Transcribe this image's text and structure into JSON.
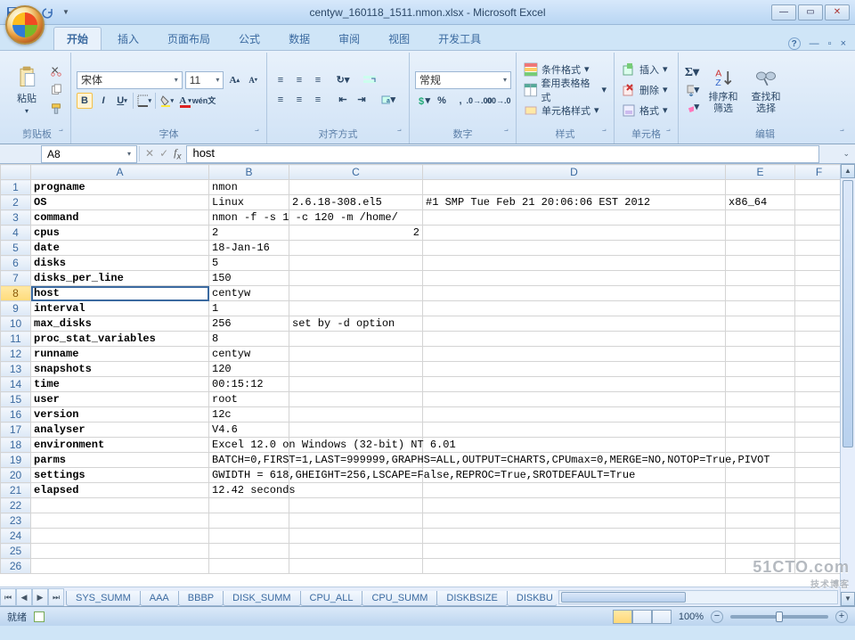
{
  "title": "centyw_160118_1511.nmon.xlsx - Microsoft Excel",
  "tabs": [
    "开始",
    "插入",
    "页面布局",
    "公式",
    "数据",
    "审阅",
    "视图",
    "开发工具"
  ],
  "active_tab": 0,
  "ribbon": {
    "clipboard": {
      "paste": "粘贴",
      "label": "剪贴板"
    },
    "font": {
      "name": "宋体",
      "size": "11",
      "label": "字体"
    },
    "align": {
      "label": "对齐方式"
    },
    "number": {
      "format": "常规",
      "label": "数字"
    },
    "styles": {
      "cond": "条件格式",
      "table": "套用表格格式",
      "cell": "单元格样式",
      "label": "样式"
    },
    "cells": {
      "insert": "插入",
      "delete": "删除",
      "format": "格式",
      "label": "单元格"
    },
    "editing": {
      "sort": "排序和\n筛选",
      "find": "查找和\n选择",
      "label": "编辑"
    }
  },
  "namebox": "A8",
  "formula": "host",
  "columns": [
    "A",
    "B",
    "C",
    "D",
    "E",
    "F"
  ],
  "selected": {
    "row": 8,
    "col": 0
  },
  "rows": [
    {
      "n": 1,
      "A": "progname",
      "B": "nmon"
    },
    {
      "n": 2,
      "A": "OS",
      "B": "Linux",
      "C": "2.6.18-308.el5",
      "D": "#1 SMP Tue Feb 21 20:06:06 EST 2012",
      "E": "x86_64"
    },
    {
      "n": 3,
      "A": "command",
      "B": "nmon -f -s 1 -c 120 -m /home/",
      "B_overflow": true
    },
    {
      "n": 4,
      "A": "cpus",
      "B": "2",
      "C": "2",
      "C_align": "right"
    },
    {
      "n": 5,
      "A": "date",
      "B": "18-Jan-16"
    },
    {
      "n": 6,
      "A": "disks",
      "B": "5"
    },
    {
      "n": 7,
      "A": "disks_per_line",
      "B": "150"
    },
    {
      "n": 8,
      "A": "host",
      "B": "centyw"
    },
    {
      "n": 9,
      "A": "interval",
      "B": "1"
    },
    {
      "n": 10,
      "A": "max_disks",
      "B": "256",
      "C": "set by -d option"
    },
    {
      "n": 11,
      "A": "proc_stat_variables",
      "B": "8"
    },
    {
      "n": 12,
      "A": "runname",
      "B": "centyw"
    },
    {
      "n": 13,
      "A": "snapshots",
      "B": "120"
    },
    {
      "n": 14,
      "A": "time",
      "B": "00:15:12"
    },
    {
      "n": 15,
      "A": "user",
      "B": "root"
    },
    {
      "n": 16,
      "A": "version",
      "B": "12c"
    },
    {
      "n": 17,
      "A": "analyser",
      "B": "V4.6"
    },
    {
      "n": 18,
      "A": "environment",
      "B": "Excel 12.0 on Windows (32-bit) NT 6.01",
      "B_overflow": true
    },
    {
      "n": 19,
      "A": "parms",
      "B": "BATCH=0,FIRST=1,LAST=999999,GRAPHS=ALL,OUTPUT=CHARTS,CPUmax=0,MERGE=NO,NOTOP=True,PIVOT",
      "B_overflow": true
    },
    {
      "n": 20,
      "A": "settings",
      "B": "GWIDTH = 618,GHEIGHT=256,LSCAPE=False,REPROC=True,SROTDEFAULT=True",
      "B_overflow": true
    },
    {
      "n": 21,
      "A": "elapsed",
      "B": "12.42 seconds",
      "B_overflow": true
    },
    {
      "n": 22
    },
    {
      "n": 23
    },
    {
      "n": 24
    },
    {
      "n": 25
    },
    {
      "n": 26
    }
  ],
  "sheets": [
    "SYS_SUMM",
    "AAA",
    "BBBP",
    "DISK_SUMM",
    "CPU_ALL",
    "CPU_SUMM",
    "DISKBSIZE",
    "DISKBU"
  ],
  "status": {
    "ready": "就绪",
    "zoom": "100%"
  },
  "watermark": {
    "main": "51CTO.com",
    "sub": "技术博客"
  }
}
